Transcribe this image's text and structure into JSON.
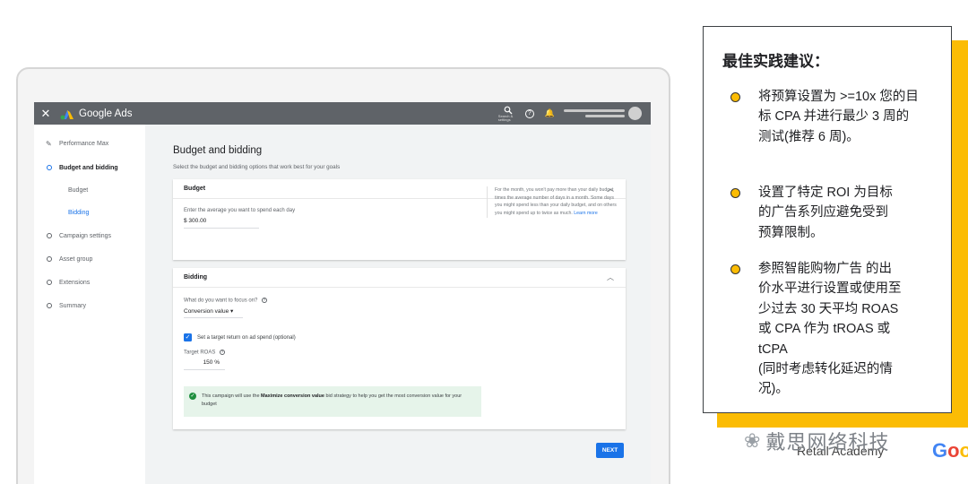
{
  "app": {
    "close": "✕",
    "brand": "Google Ads",
    "search_label": "Search & settings",
    "help": "?",
    "bell": "🔔"
  },
  "sidebar": {
    "items": [
      {
        "label": "Performance Max"
      },
      {
        "label": "Budget and bidding"
      },
      {
        "label": "Budget"
      },
      {
        "label": "Bidding"
      },
      {
        "label": "Campaign settings"
      },
      {
        "label": "Asset group"
      },
      {
        "label": "Extensions"
      },
      {
        "label": "Summary"
      }
    ]
  },
  "main": {
    "title": "Budget and bidding",
    "subtitle": "Select the budget and bidding options that work best for your goals",
    "budget": {
      "header": "Budget",
      "input_label": "Enter the average you want to spend each day",
      "input_value": "$ 300.00",
      "note": "For the month, you won't pay more than your daily budget times the average number of days in a month. Some days you might spend less than your daily budget, and on others you might spend up to twice as much.",
      "learn_more": "Learn more"
    },
    "bidding": {
      "header": "Bidding",
      "focus_label": "What do you want to focus on?",
      "focus_value": "Conversion value",
      "checkbox_label": "Set a target return on ad spend (optional)",
      "target_label": "Target ROAS",
      "target_value": "150 %",
      "info_pre": "This campaign will use the ",
      "info_bold": "Maximize conversion value",
      "info_post": " bid strategy to help you get the most conversion value for your budget"
    },
    "next": "NEXT"
  },
  "tips": {
    "title": "最佳实践建议：",
    "items": [
      {
        "text": "将预算设置为 >=10x 您的目\n标 CPA 并进行最少 3 周的\n测试(推荐 6 周)。"
      },
      {
        "text": "设置了特定 ROI 为目标\n的广告系列应避免受到\n预算限制。"
      },
      {
        "text": "参照智能购物广告 的出\n价水平进行设置或使用至\n少过去 30 天平均 ROAS\n或 CPA 作为 tROAS 或\ntCPA\n(同时考虑转化延迟的情\n况)。"
      }
    ]
  },
  "footer": {
    "watermark": "戴思网络科技",
    "sub": "Retail Academy",
    "google_partial": "Goo"
  },
  "colors": {
    "accent": "#1a73e8",
    "appbar": "#5f6368",
    "yellow": "#fbbc04",
    "success": "#1e8e3e"
  }
}
